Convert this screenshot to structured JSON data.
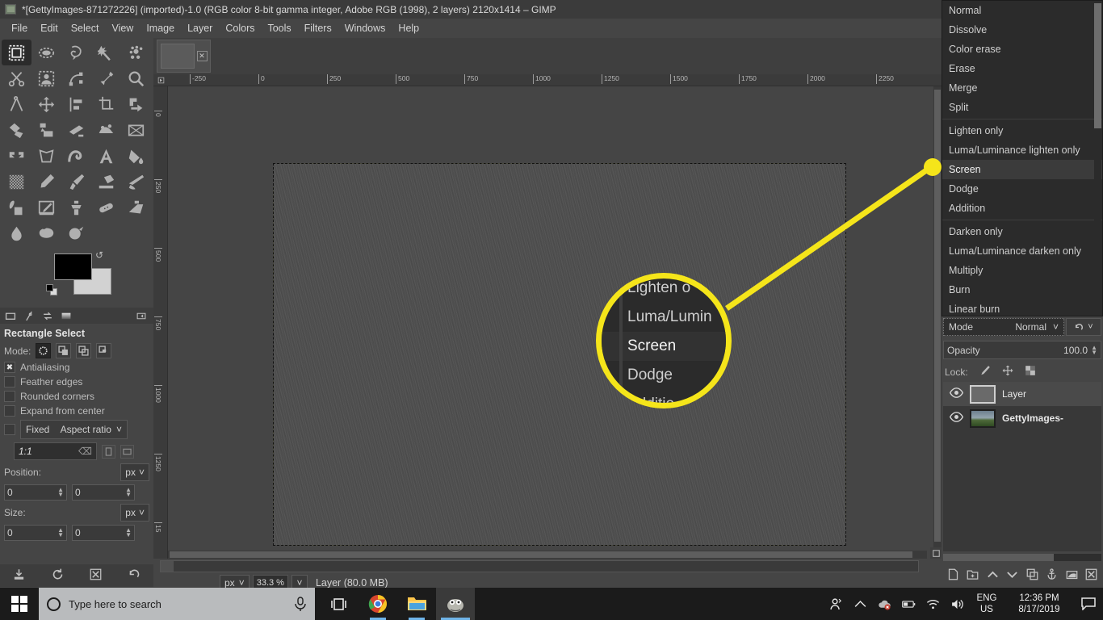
{
  "window": {
    "title": "*[GettyImages-871272226] (imported)-1.0 (RGB color 8-bit gamma integer, Adobe RGB (1998), 2 layers) 2120x1414 – GIMP",
    "app_icon": "gimp-icon"
  },
  "menubar": {
    "items": [
      "File",
      "Edit",
      "Select",
      "View",
      "Image",
      "Layer",
      "Colors",
      "Tools",
      "Filters",
      "Windows",
      "Help"
    ]
  },
  "toolbox": {
    "tools": [
      {
        "name": "rectangle-select-tool",
        "selected": true
      },
      {
        "name": "ellipse-select-tool",
        "selected": false
      },
      {
        "name": "free-select-tool",
        "selected": false
      },
      {
        "name": "fuzzy-select-tool",
        "selected": false
      },
      {
        "name": "select-by-color-tool",
        "selected": false
      },
      {
        "name": "scissors-select-tool",
        "selected": false
      },
      {
        "name": "foreground-select-tool",
        "selected": false
      },
      {
        "name": "paths-tool",
        "selected": false
      },
      {
        "name": "color-picker-tool",
        "selected": false
      },
      {
        "name": "zoom-tool",
        "selected": false
      },
      {
        "name": "measure-tool",
        "selected": false
      },
      {
        "name": "move-tool",
        "selected": false
      },
      {
        "name": "alignment-tool",
        "selected": false
      },
      {
        "name": "crop-tool",
        "selected": false
      },
      {
        "name": "rotate-tool",
        "selected": false
      },
      {
        "name": "scale-tool",
        "selected": false
      },
      {
        "name": "shear-tool",
        "selected": false
      },
      {
        "name": "perspective-tool",
        "selected": false
      },
      {
        "name": "unified-transform-tool",
        "selected": false
      },
      {
        "name": "handle-transform-tool",
        "selected": false
      },
      {
        "name": "flip-tool",
        "selected": false
      },
      {
        "name": "cage-transform-tool",
        "selected": false
      },
      {
        "name": "warp-transform-tool",
        "selected": false
      },
      {
        "name": "text-tool",
        "selected": false
      },
      {
        "name": "bucket-fill-tool",
        "selected": false
      },
      {
        "name": "gradient-tool",
        "selected": false
      },
      {
        "name": "pencil-tool",
        "selected": false
      },
      {
        "name": "paintbrush-tool",
        "selected": false
      },
      {
        "name": "eraser-tool",
        "selected": false
      },
      {
        "name": "airbrush-tool",
        "selected": false
      },
      {
        "name": "ink-tool",
        "selected": false
      },
      {
        "name": "mypaint-brush-tool",
        "selected": false
      },
      {
        "name": "clone-tool",
        "selected": false
      },
      {
        "name": "heal-tool",
        "selected": false
      },
      {
        "name": "perspective-clone-tool",
        "selected": false
      },
      {
        "name": "blur-sharpen-tool",
        "selected": false
      },
      {
        "name": "smudge-tool",
        "selected": false
      },
      {
        "name": "dodge-burn-tool",
        "selected": false
      }
    ],
    "foreground_color": "#000000",
    "background_color": "#d2d2d2",
    "bottom_icons": [
      "image-icon",
      "brush-icon",
      "swap-icon",
      "gradient-icon",
      "speaker-icon"
    ]
  },
  "tool_options": {
    "title": "Rectangle Select",
    "mode_label": "Mode:",
    "mode_buttons": [
      "replace-selection",
      "add-to-selection",
      "subtract-from-selection",
      "intersect-with-selection"
    ],
    "checkboxes": [
      {
        "label": "Antialiasing",
        "checked": true
      },
      {
        "label": "Feather edges",
        "checked": false
      },
      {
        "label": "Rounded corners",
        "checked": false
      },
      {
        "label": "Expand from center",
        "checked": false
      }
    ],
    "fixed": {
      "label": "Fixed",
      "checked": false,
      "value": "Aspect ratio"
    },
    "ratio_value": "1:1",
    "position": {
      "label": "Position:",
      "unit": "px",
      "x": "0",
      "y": "0"
    },
    "size": {
      "label": "Size:",
      "unit": "px",
      "w": "0",
      "h": "0"
    },
    "footer_buttons": [
      "save-tool-preset",
      "restore-tool-preset",
      "delete-tool-preset",
      "reset-tool-options"
    ]
  },
  "image_window": {
    "tab_close_label": "✕",
    "ruler_h_marks": [
      "-250",
      "0",
      "250",
      "500",
      "750",
      "1000",
      "1250",
      "1500",
      "1750",
      "2000",
      "2250"
    ],
    "ruler_v_marks": [
      "0",
      "250",
      "500",
      "750",
      "1000",
      "1250",
      "15"
    ],
    "statusbar": {
      "unit": "px",
      "zoom": "33.3 %",
      "message": "Layer (80.0 MB)"
    }
  },
  "blend_dropdown": {
    "items": [
      {
        "label": "Normal",
        "highlighted": false,
        "separator_after": false
      },
      {
        "label": "Dissolve",
        "highlighted": false,
        "separator_after": false
      },
      {
        "label": "Color erase",
        "highlighted": false,
        "separator_after": false
      },
      {
        "label": "Erase",
        "highlighted": false,
        "separator_after": false
      },
      {
        "label": "Merge",
        "highlighted": false,
        "separator_after": false
      },
      {
        "label": "Split",
        "highlighted": false,
        "separator_after": true
      },
      {
        "label": "Lighten only",
        "highlighted": false,
        "separator_after": false
      },
      {
        "label": "Luma/Luminance lighten only",
        "highlighted": false,
        "separator_after": false
      },
      {
        "label": "Screen",
        "highlighted": true,
        "separator_after": false
      },
      {
        "label": "Dodge",
        "highlighted": false,
        "separator_after": false
      },
      {
        "label": "Addition",
        "highlighted": false,
        "separator_after": true
      },
      {
        "label": "Darken only",
        "highlighted": false,
        "separator_after": false
      },
      {
        "label": "Luma/Luminance darken only",
        "highlighted": false,
        "separator_after": false
      },
      {
        "label": "Multiply",
        "highlighted": false,
        "separator_after": false
      },
      {
        "label": "Burn",
        "highlighted": false,
        "separator_after": false
      },
      {
        "label": "Linear burn",
        "highlighted": false,
        "separator_after": false
      }
    ]
  },
  "callout": {
    "accent_color": "#f5e51a",
    "items": [
      {
        "label": "Lighten o",
        "highlighted": false
      },
      {
        "label": "Luma/Lumin",
        "highlighted": false
      },
      {
        "label": "Screen",
        "highlighted": true
      },
      {
        "label": "Dodge",
        "highlighted": false
      },
      {
        "label": "Additio",
        "highlighted": false
      }
    ]
  },
  "layers_panel": {
    "mode_label": "Mode",
    "mode_value": "Normal",
    "opacity_label": "Opacity",
    "opacity_value": "100.0",
    "lock_label": "Lock:",
    "lock_icons": [
      "lock-pixels-icon",
      "lock-position-icon",
      "lock-alpha-icon"
    ],
    "layers": [
      {
        "name": "Layer",
        "selected": true,
        "visible": true,
        "thumb": "gray"
      },
      {
        "name": "GettyImages-",
        "selected": false,
        "visible": true,
        "thumb": "photo"
      }
    ],
    "buttons": [
      "new-layer",
      "new-layer-group",
      "raise-layer",
      "lower-layer",
      "duplicate-layer",
      "anchor-layer",
      "layer-mask",
      "delete-layer"
    ]
  },
  "taskbar": {
    "search_placeholder": "Type here to search",
    "apps": [
      {
        "name": "chrome",
        "active": false,
        "open": true
      },
      {
        "name": "file-explorer",
        "active": false,
        "open": true
      },
      {
        "name": "gimp",
        "active": true,
        "open": true
      }
    ],
    "tray": {
      "language_line1": "ENG",
      "language_line2": "US",
      "time": "12:36 PM",
      "date": "8/17/2019"
    }
  }
}
